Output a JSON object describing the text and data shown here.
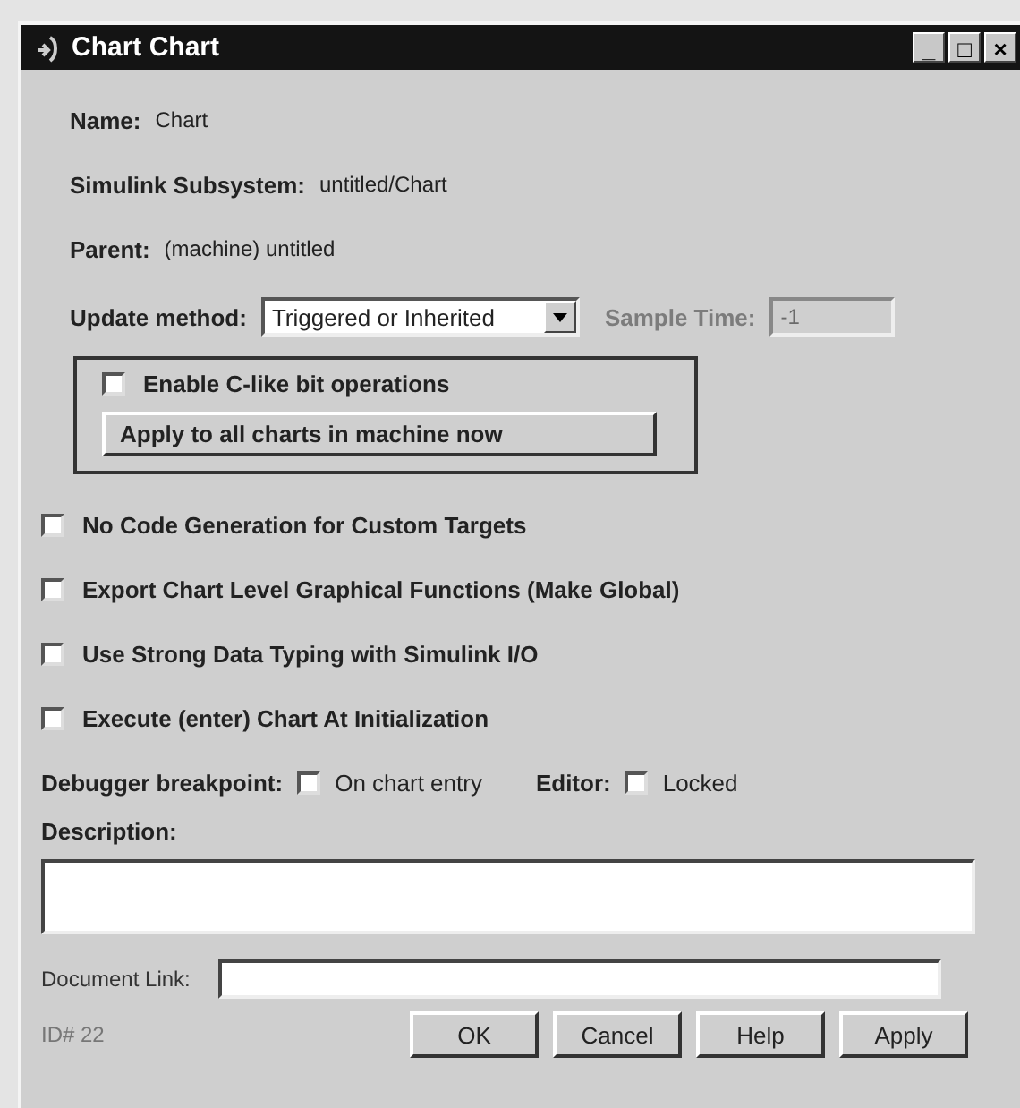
{
  "window": {
    "title": "Chart Chart",
    "controls": [
      "_",
      "□",
      "×"
    ]
  },
  "info": [
    {
      "label": "Name:",
      "value": "Chart"
    },
    {
      "label": "Simulink Subsystem:",
      "value": "untitled/Chart"
    },
    {
      "label": "Parent:",
      "value": "(machine) untitled"
    }
  ],
  "update_method": {
    "label": "Update method:",
    "value": "Triggered or Inherited"
  },
  "sample_time": {
    "label": "Sample Time:",
    "value": "-1",
    "disabled": true
  },
  "group": {
    "checkbox": {
      "label": "Enable C-like bit operations",
      "checked": false
    },
    "button": "Apply to all charts in machine now"
  },
  "options": [
    {
      "label": "No Code Generation for Custom Targets",
      "checked": false
    },
    {
      "label": "Export Chart Level Graphical Functions (Make Global)",
      "checked": false
    },
    {
      "label": "Use Strong Data Typing with Simulink I/O",
      "checked": false
    },
    {
      "label": "Execute (enter) Chart At Initialization",
      "checked": false
    }
  ],
  "debugger": {
    "label": "Debugger breakpoint:",
    "checkbox": {
      "label": "On chart entry",
      "checked": false
    }
  },
  "editor": {
    "label": "Editor:",
    "checkbox": {
      "label": "Locked",
      "checked": false
    }
  },
  "description": {
    "label": "Description:"
  },
  "document_link": {
    "label": "Document Link:"
  },
  "id": "ID# 22",
  "buttons": [
    "OK",
    "Cancel",
    "Help",
    "Apply"
  ]
}
